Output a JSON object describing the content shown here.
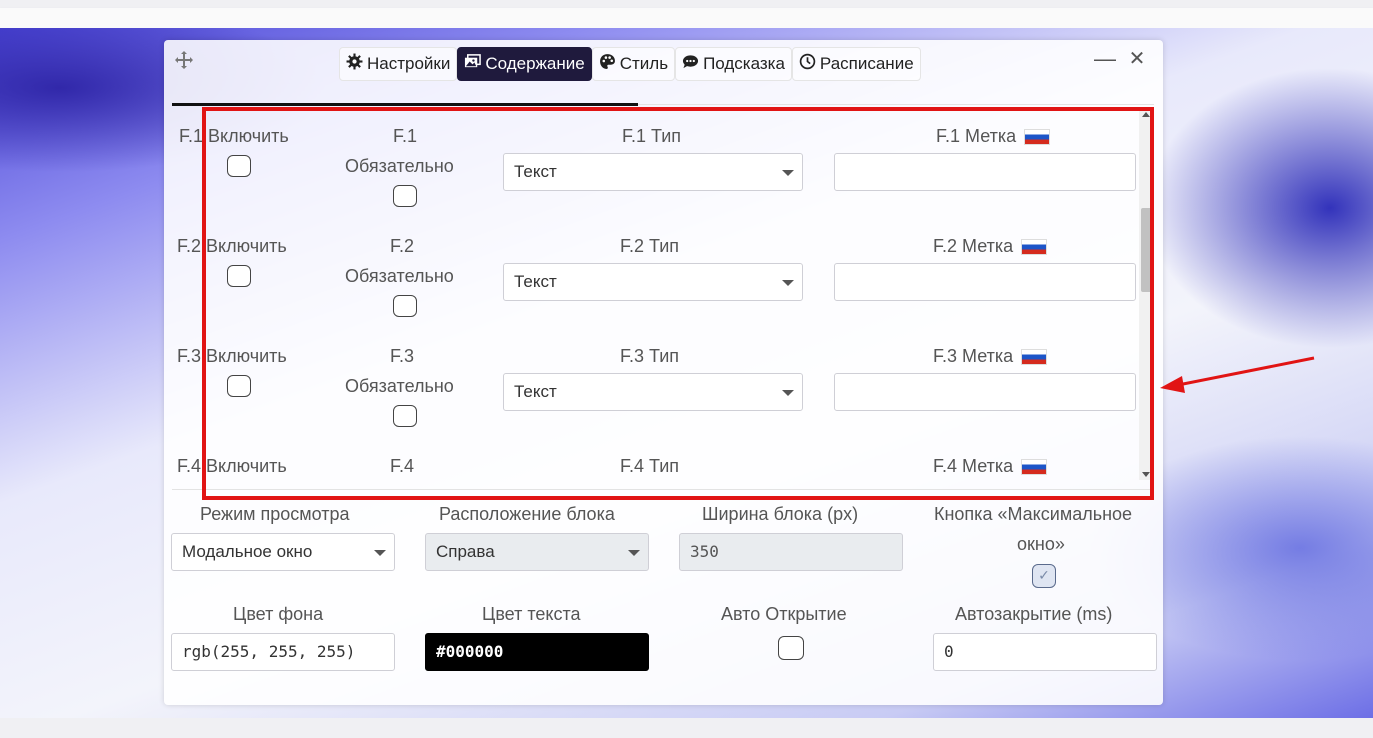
{
  "tabs": [
    {
      "label": "Настройки",
      "icon": "gear-icon",
      "active": false
    },
    {
      "label": "Содержание",
      "icon": "images-icon",
      "active": true
    },
    {
      "label": "Стиль",
      "icon": "palette-icon",
      "active": false
    },
    {
      "label": "Подсказка",
      "icon": "comment-dots-icon",
      "active": false
    },
    {
      "label": "Расписание",
      "icon": "clock-icon",
      "active": false
    }
  ],
  "window_controls": {
    "minimize": "—",
    "close": "✕"
  },
  "fields": [
    {
      "enable_label": "F.1 Включить",
      "required_label": "F.1",
      "required_word": "Обязательно",
      "type_label": "F.1 Тип",
      "type_value": "Текст",
      "tag_label": "F.1 Метка",
      "tag_value": ""
    },
    {
      "enable_label": "F.2 Включить",
      "required_label": "F.2",
      "required_word": "Обязательно",
      "type_label": "F.2 Тип",
      "type_value": "Текст",
      "tag_label": "F.2 Метка",
      "tag_value": ""
    },
    {
      "enable_label": "F.3 Включить",
      "required_label": "F.3",
      "required_word": "Обязательно",
      "type_label": "F.3 Тип",
      "type_value": "Текст",
      "tag_label": "F.3 Метка",
      "tag_value": ""
    },
    {
      "enable_label": "F.4 Включить",
      "required_label": "F.4",
      "type_label": "F.4 Тип",
      "tag_label": "F.4 Метка"
    }
  ],
  "settings": {
    "view_mode_label": "Режим просмотра",
    "view_mode_value": "Модальное окно",
    "position_label": "Расположение блока",
    "position_value": "Справа",
    "width_label": "Ширина блока (px)",
    "width_value": "350",
    "max_window_label_1": "Кнопка «Максимальное",
    "max_window_label_2": "окно»",
    "max_window_checked": true,
    "bg_color_label": "Цвет фона",
    "bg_color_value": "rgb(255, 255, 255)",
    "text_color_label": "Цвет текста",
    "text_color_value": "#000000",
    "auto_open_label": "Авто Открытие",
    "auto_open_checked": false,
    "auto_close_label": "Автозакрытие (ms)",
    "auto_close_value": "0"
  },
  "colors": {
    "accent_tab": "#1f1a3d",
    "highlight": "#e11414"
  }
}
